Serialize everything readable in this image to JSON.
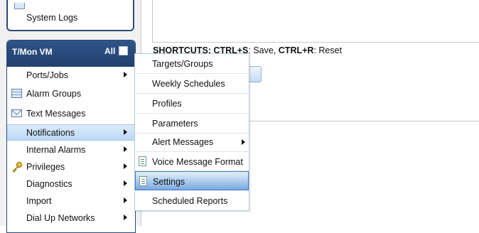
{
  "sidebar": {
    "top_panel": {
      "item": "System Logs"
    },
    "vm_panel": {
      "title": "T/Mon VM",
      "all_label": "All",
      "items": [
        {
          "label": "Ports/Jobs",
          "icon": "none",
          "submenu": true
        },
        {
          "label": "Alarm Groups",
          "icon": "list-icon",
          "submenu": false
        },
        {
          "label": "Text Messages",
          "icon": "envelope-icon",
          "submenu": false
        },
        {
          "label": "Notifications",
          "icon": "none",
          "submenu": true,
          "active": true
        },
        {
          "label": "Internal Alarms",
          "icon": "none",
          "submenu": true
        },
        {
          "label": "Privileges",
          "icon": "key-icon",
          "submenu": true
        },
        {
          "label": "Diagnostics",
          "icon": "none",
          "submenu": true
        },
        {
          "label": "Import",
          "icon": "none",
          "submenu": true
        },
        {
          "label": "Dial Up Networks",
          "icon": "none",
          "submenu": true
        }
      ]
    }
  },
  "main": {
    "shortcuts": {
      "prefix": "SHORTCUTS: ",
      "key1": "CTRL+S",
      "action1": ": Save, ",
      "key2": "CTRL+R",
      "action2": ": Reset"
    }
  },
  "submenu": {
    "items": [
      {
        "label": "Targets/Groups"
      },
      {
        "label": "Weekly Schedules"
      },
      {
        "label": "Profiles"
      },
      {
        "label": "Parameters"
      },
      {
        "label": "Alert Messages",
        "submenu": true
      },
      {
        "label": "Voice Message Format",
        "icon": "document-icon"
      },
      {
        "label": "Settings",
        "icon": "document-icon",
        "selected": true
      },
      {
        "label": "Scheduled Reports"
      }
    ]
  },
  "colors": {
    "header_blue": "#21406d",
    "active_highlight": "#bcd7f5",
    "selected_menu": "#7aa9df"
  }
}
